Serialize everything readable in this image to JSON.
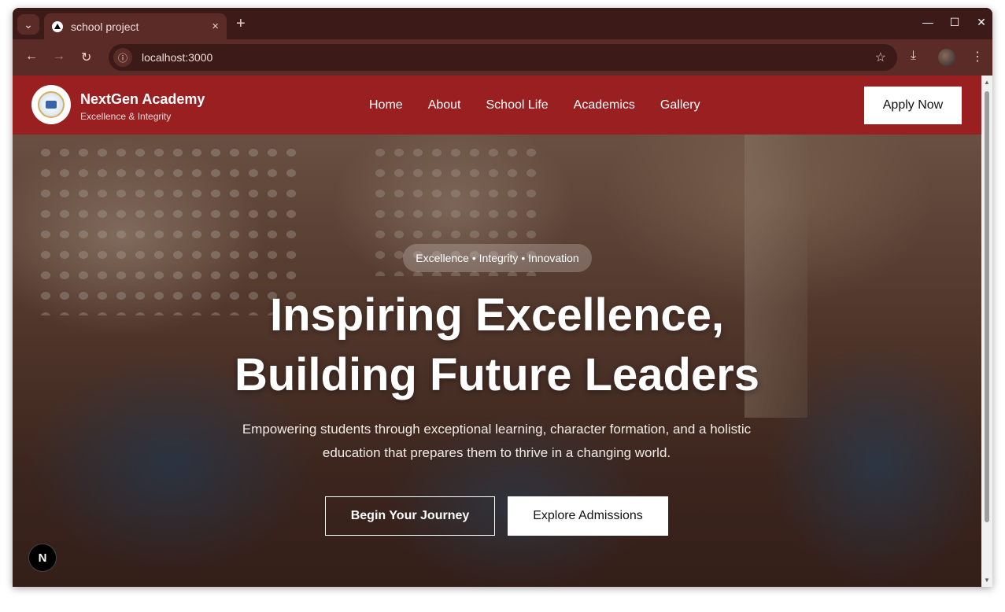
{
  "browser": {
    "tab_title": "school project",
    "url": "localhost:3000",
    "tab_close": "×",
    "new_tab": "+",
    "minimize": "—",
    "maximize": "☐",
    "close": "✕",
    "back": "←",
    "forward": "→",
    "reload": "↻",
    "info": "ⓘ",
    "bookmark": "☆",
    "download": "⤓",
    "menu": "⋮",
    "tab_search": "⌄"
  },
  "site": {
    "brand_name": "NextGen Academy",
    "brand_tagline": "Excellence & Integrity",
    "nav": [
      "Home",
      "About",
      "School Life",
      "Academics",
      "Gallery"
    ],
    "apply_label": "Apply Now"
  },
  "hero": {
    "badge": "Excellence • Integrity • Innovation",
    "headline_line1": "Inspiring Excellence,",
    "headline_line2": "Building Future Leaders",
    "subtext": "Empowering students through exceptional learning, character formation, and a holistic education that prepares them to thrive in a changing world.",
    "primary_cta": "Begin Your Journey",
    "secondary_cta": "Explore Admissions"
  },
  "dev_badge": "N",
  "colors": {
    "nav_bg": "#9a1f21",
    "browser_frame": "#3b1a18",
    "browser_toolbar": "#5a2b27"
  }
}
